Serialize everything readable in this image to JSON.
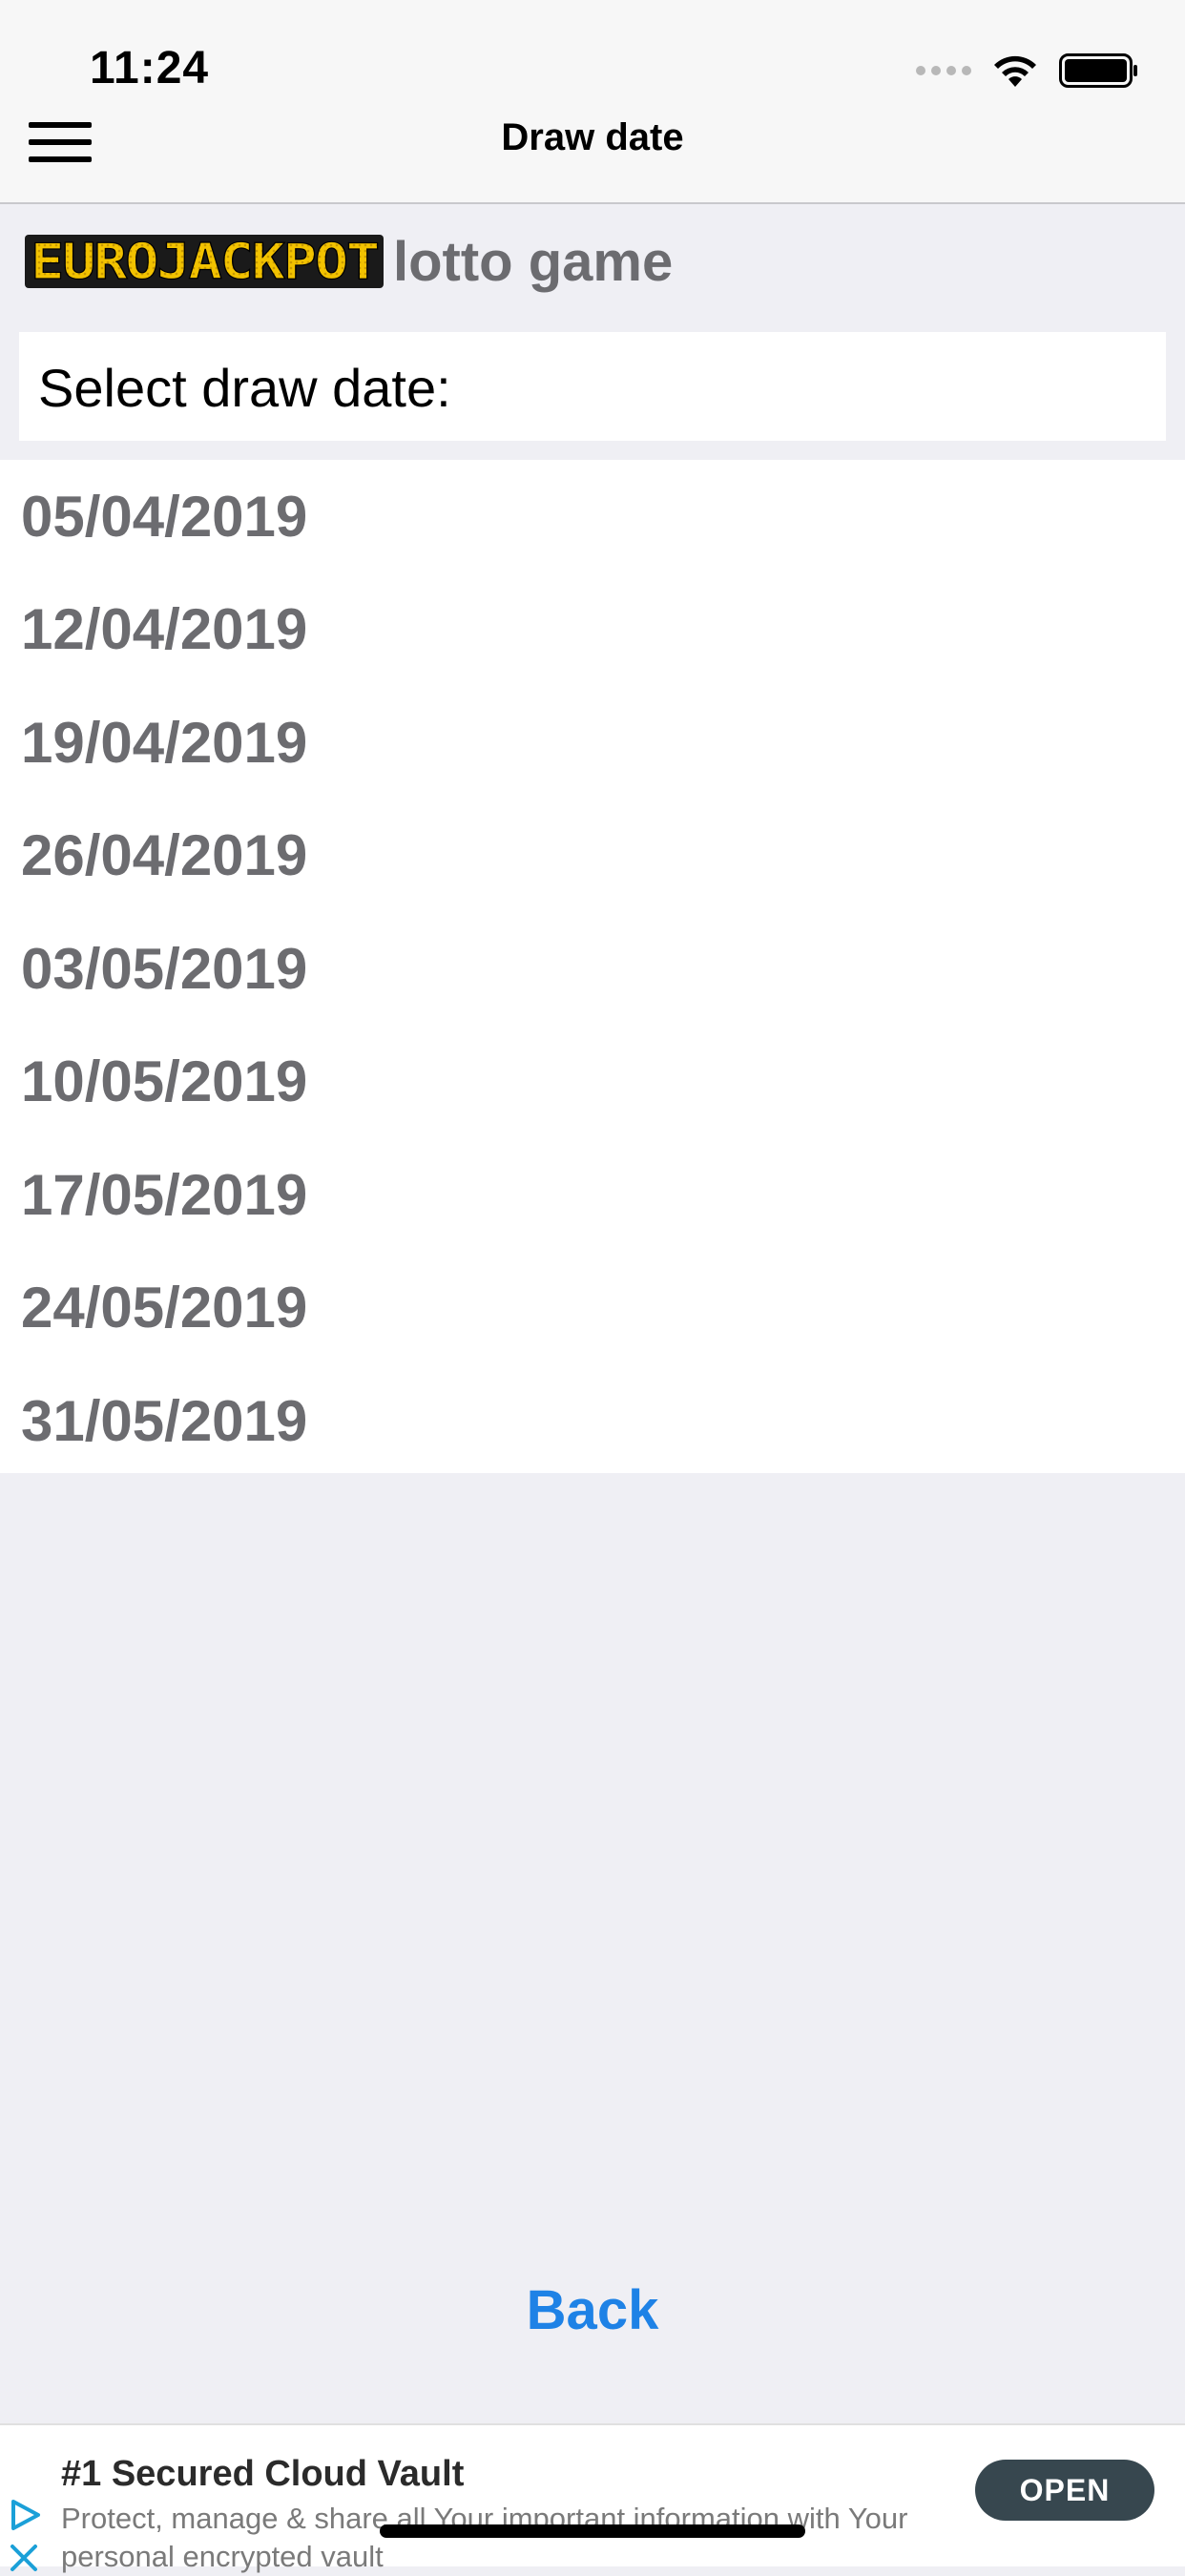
{
  "status_bar": {
    "time": "11:24"
  },
  "nav": {
    "title": "Draw date"
  },
  "header": {
    "logo_text": "EUROJACKPOT",
    "subtitle": "lotto game"
  },
  "select": {
    "label": "Select draw date:"
  },
  "dates": [
    "05/04/2019",
    "12/04/2019",
    "19/04/2019",
    "26/04/2019",
    "03/05/2019",
    "10/05/2019",
    "17/05/2019",
    "24/05/2019",
    "31/05/2019"
  ],
  "footer": {
    "back_label": "Back"
  },
  "ad": {
    "title": "#1 Secured Cloud Vault",
    "description": "Protect, manage & share all Your important information with Your personal encrypted vault",
    "open_label": "OPEN"
  },
  "colors": {
    "accent": "#1e82e6",
    "logo_yellow": "#f2c200",
    "ad_button": "#37474f"
  }
}
